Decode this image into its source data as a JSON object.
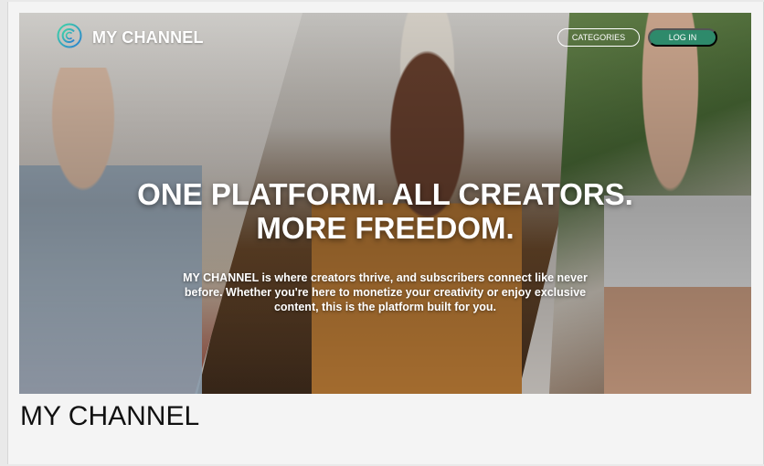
{
  "nav": {
    "logo_text": "MY CHANNEL",
    "logo_icon": "concentric-c-logo-icon",
    "categories_label": "CATEGORIES",
    "login_label": "LOG IN"
  },
  "hero": {
    "headline_line1": "ONE PLATFORM. ALL CREATORS.",
    "headline_line2": "MORE FREEDOM.",
    "subtext": "MY CHANNEL is where creators thrive, and subscribers connect like never before. Whether you're here to monetize your creativity or enjoy exclusive content, this is the platform built for you."
  },
  "footer": {
    "site_name": "MY CHANNEL"
  },
  "colors": {
    "accent": "#2e8a6b",
    "text_light": "#ffffff",
    "text_dark": "#111111"
  }
}
